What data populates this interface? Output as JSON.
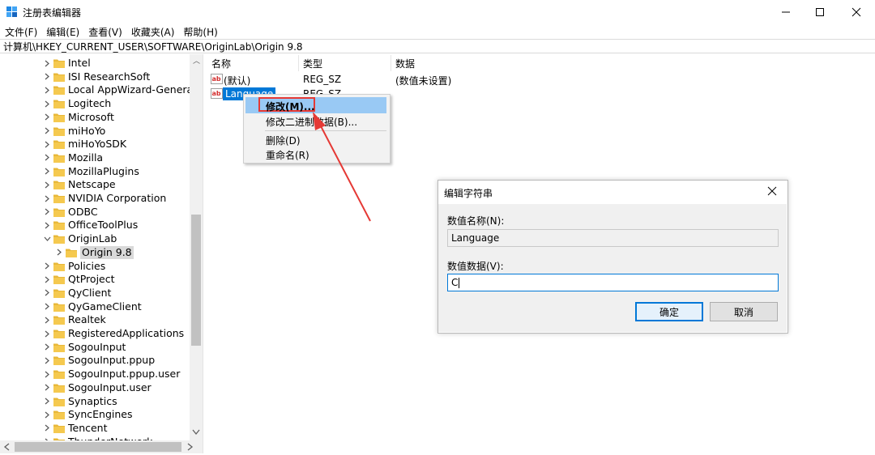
{
  "window": {
    "title": "注册表编辑器"
  },
  "menu": [
    "文件(F)",
    "编辑(E)",
    "查看(V)",
    "收藏夹(A)",
    "帮助(H)"
  ],
  "address": "计算机\\HKEY_CURRENT_USER\\SOFTWARE\\OriginLab\\Origin 9.8",
  "tree": {
    "items": [
      "Intel",
      "ISI ResearchSoft",
      "Local AppWizard-Generate",
      "Logitech",
      "Microsoft",
      "miHoYo",
      "miHoYoSDK",
      "Mozilla",
      "MozillaPlugins",
      "Netscape",
      "NVIDIA Corporation",
      "ODBC",
      "OfficeToolPlus",
      "OriginLab",
      "Origin 9.8",
      "Policies",
      "QtProject",
      "QyClient",
      "QyGameClient",
      "Realtek",
      "RegisteredApplications",
      "SogouInput",
      "SogouInput.ppup",
      "SogouInput.ppup.user",
      "SogouInput.user",
      "Synaptics",
      "SyncEngines",
      "Tencent",
      "ThunderNetwork"
    ]
  },
  "list": {
    "headers": {
      "name": "名称",
      "type": "类型",
      "data": "数据"
    },
    "rows": [
      {
        "name": "(默认)",
        "type": "REG_SZ",
        "data": "(数值未设置)"
      },
      {
        "name": "Language",
        "type": "REG_SZ",
        "data": ""
      }
    ]
  },
  "context_menu": {
    "items": [
      "修改(M)...",
      "修改二进制数据(B)...",
      "删除(D)",
      "重命名(R)"
    ]
  },
  "dialog": {
    "title": "编辑字符串",
    "name_label": "数值名称(N):",
    "name_value": "Language",
    "data_label": "数值数据(V):",
    "data_value": "C",
    "ok_label": "确定",
    "cancel_label": "取消"
  },
  "colors": {
    "highlight": "#99c9f4",
    "annotation_red": "#e53935",
    "folder": "#e8b83a",
    "selection_blue": "#0078d7"
  },
  "icons": [
    "regedit-app-icon",
    "minimize-icon",
    "maximize-icon",
    "close-icon",
    "folder-icon",
    "chevron-right-icon",
    "chevron-down-icon",
    "string-value-icon"
  ]
}
